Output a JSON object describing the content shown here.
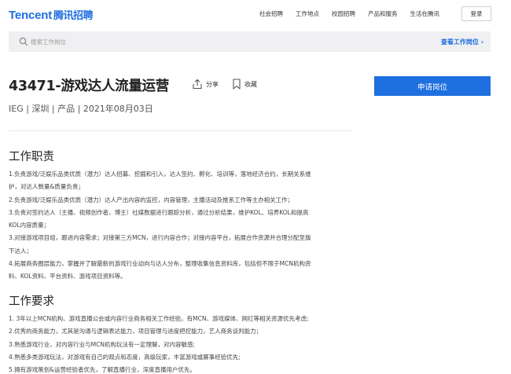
{
  "brand": {
    "logo_en": "Tencent",
    "logo_cn": "腾讯招聘",
    "color": "#1e6fe0"
  },
  "nav": {
    "links": [
      "社会招聘",
      "工作地点",
      "校园招聘",
      "产品和服务",
      "生活在腾讯"
    ],
    "login": "登录"
  },
  "search": {
    "placeholder": "搜索工作岗位",
    "view_jobs": "查看工作岗位 ›"
  },
  "job": {
    "title": "43471-游戏达人流量运营",
    "share": "分享",
    "collect": "收藏",
    "meta": "IEG | 深圳 | 产品 | 2021年08月03日",
    "apply": "申请岗位"
  },
  "duties": {
    "title": "工作职责",
    "lines": [
      "1.负责游戏/泛娱乐品类优质（潜力）达人招募、挖掘和引入，达人签约、孵化、培训等，落地经济合约，长期关系维",
      "护，对达人数量&质量负责；",
      "2.负责游戏/泛娱乐品类优质（潜力）达人产出内容的监控，内容管理，主播活动及推系工作等主办相关工作；",
      "3.负责对签约达人（主播、视频创作者、博主）社媒数据进行跟踪分析，通过分析结果，维护KOL、培养KOL和提高",
      "KOL内容质量；",
      "3.对接游戏项目组，跟进内容需求；对接第三方MCN，进行内容合作；对接内容平台，拓展合作资源并合理分配至旗",
      "下达人；",
      "4.拓展商务圈层能力，掌握并了解最新的游戏行业动向与达人分布，整理收集信息资料库，包括但不限于MCN机构资",
      "料、KOL资料、平台资料、游戏项目资料等。"
    ]
  },
  "requirements": {
    "title": "工作要求",
    "lines": [
      "1. 3年以上MCN机构、游戏直播公会或内容行业商务相关工作经验。有MCN、游戏媒体、网红等相关资源优先考虑;",
      "2.优秀的商务能力，尤其是沟通与逻辑表达能力，项目管理与进度把控能力，艺人商务谈判能力；",
      "3.熟悉游戏行业，对内容行业与MCN机构玩法有一定理解，对内容敏感;",
      "4.熟悉多类游戏玩法，对游戏有自己的观点和态度，高级玩家，丰富游戏或赛事经验优先;",
      "5.拥有游戏策划&运营经验者优先，了解直播行业，深度直播用户优先。"
    ]
  }
}
